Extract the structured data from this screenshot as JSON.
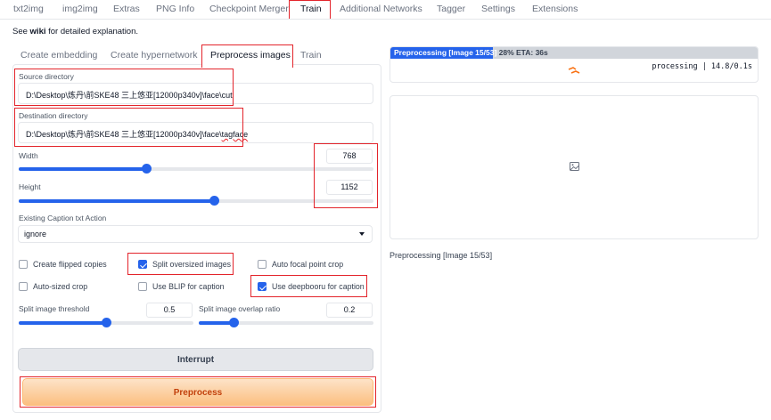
{
  "top_tabs": [
    "txt2img",
    "img2img",
    "Extras",
    "PNG Info",
    "Checkpoint Merger",
    "Train",
    "Additional Networks",
    "Tagger",
    "Settings",
    "Extensions"
  ],
  "active_top_tab": "Train",
  "wiki_line": {
    "prefix": "See ",
    "link": "wiki",
    "suffix": " for detailed explanation."
  },
  "sub_tabs": [
    "Create embedding",
    "Create hypernetwork",
    "Preprocess images",
    "Train"
  ],
  "active_sub_tab": "Preprocess images",
  "source_directory": {
    "label": "Source directory",
    "value": "D:\\Desktop\\炼丹\\前SKE48 三上悠亚[12000p340v]\\face\\cut"
  },
  "destination_directory": {
    "label": "Destination directory",
    "value_prefix": "D:\\Desktop\\炼丹\\前SKE48 三上悠亚[12000p340v]\\face\\",
    "value_underlined": "tagface"
  },
  "width": {
    "label": "Width",
    "value": "768",
    "fraction": 0.36
  },
  "height": {
    "label": "Height",
    "value": "1152",
    "fraction": 0.55
  },
  "caption_action": {
    "label": "Existing Caption txt Action",
    "value": "ignore"
  },
  "checkboxes": {
    "create_flipped": {
      "label": "Create flipped copies",
      "checked": false
    },
    "split_oversized": {
      "label": "Split oversized images",
      "checked": true
    },
    "auto_focal": {
      "label": "Auto focal point crop",
      "checked": false
    },
    "auto_sized": {
      "label": "Auto-sized crop",
      "checked": false
    },
    "use_blip": {
      "label": "Use BLIP for caption",
      "checked": false
    },
    "use_deepbooru": {
      "label": "Use deepbooru for caption",
      "checked": true
    }
  },
  "split_threshold": {
    "label": "Split image threshold",
    "value": "0.5",
    "fraction": 0.5
  },
  "overlap_ratio": {
    "label": "Split image overlap ratio",
    "value": "0.2",
    "fraction": 0.2
  },
  "buttons": {
    "interrupt": "Interrupt",
    "preprocess": "Preprocess"
  },
  "progress": {
    "label": "Preprocessing [Image 15/53]",
    "rest": " 28% ETA: 36s",
    "percent": 28
  },
  "processing_text": "processing | 14.8/0.1s",
  "status_text": "Preprocessing [Image 15/53]",
  "colors": {
    "accent": "#2563eb",
    "highlight_red": "#e3242b",
    "primary_button": "#fbbf80"
  }
}
